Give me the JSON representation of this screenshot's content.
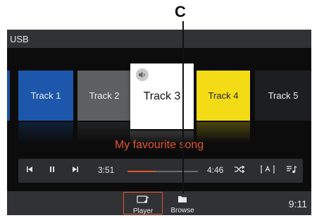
{
  "callout": {
    "letter": "C"
  },
  "header": {
    "title": "USB"
  },
  "tracks": [
    {
      "label": "Track 1",
      "color": "#1d57ab"
    },
    {
      "label": "Track 2",
      "color": "#5d5f61"
    },
    {
      "label": "Track 3",
      "color": "#ffffff"
    },
    {
      "label": "Track 4",
      "color": "#f3dc15"
    },
    {
      "label": "Track 5",
      "color": "#1d1e20"
    }
  ],
  "now_playing": {
    "song": "My favourite song"
  },
  "player": {
    "elapsed": "3:51",
    "total": "4:46",
    "progress_fraction": 0.4,
    "icons": [
      "previous-icon",
      "pause-icon",
      "next-icon",
      "shuffle-icon",
      "text-display-icon",
      "queue-icon"
    ]
  },
  "tabs": {
    "player_label": "Player",
    "browse_label": "Browse"
  },
  "status": {
    "clock": "9:11"
  },
  "colors": {
    "accent": "#e4552e"
  }
}
